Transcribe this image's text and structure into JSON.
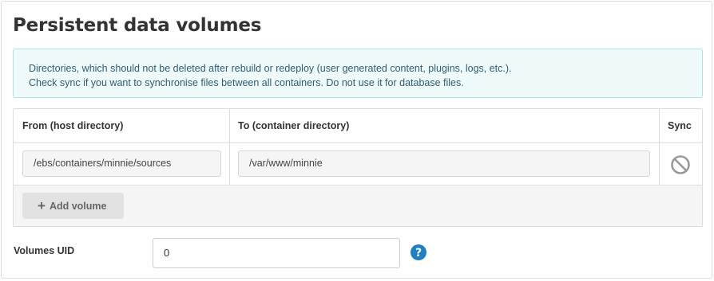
{
  "section": {
    "title": "Persistent data volumes"
  },
  "info": {
    "line1": "Directories, which should not be deleted after rebuild or redeploy (user generated content, plugins, logs, etc.).",
    "line2": "Check sync if you want to synchronise files between all containers. Do not use it for database files."
  },
  "table": {
    "headers": {
      "from": "From (host directory)",
      "to": "To (container directory)",
      "sync": "Sync"
    },
    "rows": [
      {
        "from": "/ebs/containers/minnie/sources",
        "to": "/var/www/minnie",
        "sync_icon": "ban-icon",
        "sync_enabled": false
      }
    ],
    "add_button": {
      "icon": "plus-icon",
      "label": "Add volume"
    }
  },
  "uid": {
    "label": "Volumes UID",
    "value": "0",
    "help_icon": "question-circle-icon"
  },
  "colors": {
    "info_bg": "#effafa",
    "info_border": "#aee3e6",
    "info_text": "#2f5d75",
    "help_icon": "#1e7fc4",
    "sync_icon": "#9a9a9a"
  }
}
